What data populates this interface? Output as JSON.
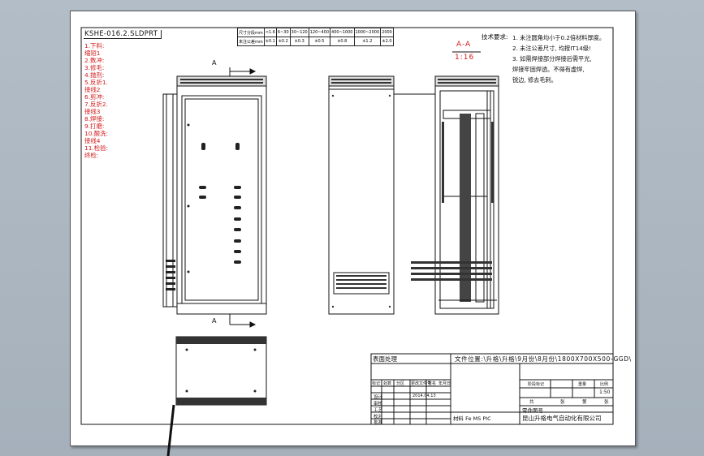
{
  "drawing": {
    "file_name": "KSHE-016.2.SLDPRT",
    "notes_left": [
      "1.下料:",
      "  缩短1",
      "2.数冲:",
      "3.修毛:",
      "4.抛剂:",
      "5.反折1.",
      "  接线2",
      "6.剪冲:",
      "7.反折2.",
      "  接线3",
      "8.焊接:",
      "9.打磨:",
      "10.酸洗:",
      "  接线4",
      "11.检验:",
      "  终检:"
    ],
    "tol_table": {
      "row1": [
        "尺寸分段mm",
        "<1.6",
        "6~30",
        "30~120",
        "120~400",
        "400~1000",
        "1000~2000",
        "2000"
      ],
      "row2": [
        "未注公差mm",
        "±0.1",
        "±0.2",
        "±0.3",
        "±0.5",
        "±0.8",
        "±1.2",
        "±2.0"
      ]
    },
    "tech_title": "技术要求:",
    "tech_notes": [
      "1. 未注圆角均小于0.2倍材料厚度。",
      "2. 未注公差尺寸, 均按IT14级!",
      "3. 如需焊接部分焊接后需平光,",
      "   焊接牢固焊透。不得有虚焊,",
      "   锐边, 修去毛刺。"
    ],
    "section_label": "A-A",
    "section_scale": "1:16",
    "view_arrow_label": "A",
    "title_block": {
      "process_label": "表面处理",
      "path": "文件位置:\\升格\\升格\\9月份\\8月份\\1800X700X500-GGD\\",
      "rev_headers": [
        "标记",
        "处数",
        "分区",
        "更改文件号",
        "签名",
        "年月日"
      ],
      "date": "2014.04.13",
      "roles": [
        "设计",
        "审核",
        "工艺",
        "校对",
        "批准"
      ],
      "stage_headers": [
        "阶段标记",
        "重量",
        "比例"
      ],
      "scale": "1:50",
      "sheet_info": [
        "共",
        "张",
        "第",
        "张"
      ],
      "part_label": "零件图号",
      "material_note": "材料 Fe MS PIC",
      "company": "昆山升格电气自动化有限公司"
    }
  }
}
